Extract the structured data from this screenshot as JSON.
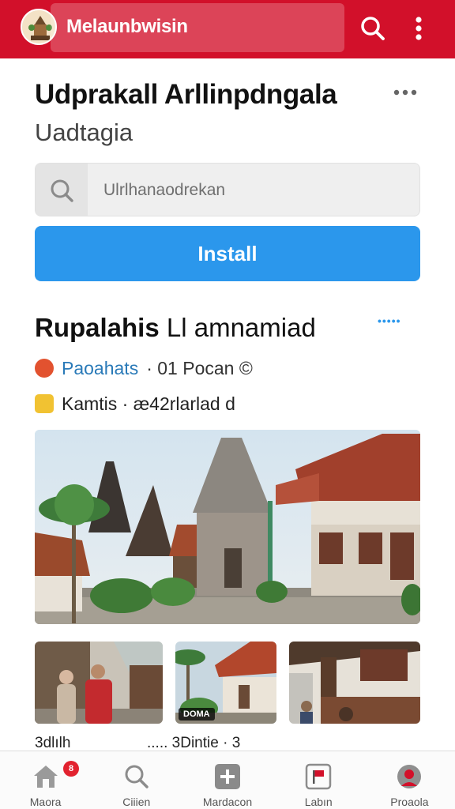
{
  "app_bar": {
    "title": "Melaunbwisin",
    "logo_icon": "temple-avatar-icon",
    "search_icon": "search-icon",
    "more_icon": "more-vertical-icon",
    "color": "#d2102a"
  },
  "header": {
    "title": "Udprakall Arllinpdngala",
    "subtitle": "Uadtagia",
    "more_icon": "more-horizontal-icon"
  },
  "search": {
    "placeholder": "Ulrlhanaodrekan",
    "icon": "search-icon"
  },
  "install_button": {
    "label": "Install",
    "color": "#2b97ec"
  },
  "section": {
    "title_bold": "Rupalahis",
    "title_light": "Ll amnamiad",
    "more_label": "•••••",
    "meta_1": {
      "icon": "location-badge-icon",
      "link": "Paoahats",
      "rest": "· 01 Pocan ©"
    },
    "meta_2": {
      "icon": "tag-icon",
      "rest": "Kamtis · æ42rlarlad d"
    }
  },
  "gallery": {
    "hero_alt": "temple-complex-photo",
    "thumbs": [
      {
        "name": "people-photo"
      },
      {
        "name": "village-photo",
        "label": "DOMA"
      },
      {
        "name": "house-photo"
      }
    ],
    "caption_1": "3dlılh",
    "caption_2": "..... 3Dintie · 3"
  },
  "bottom_nav": [
    {
      "label": "Maora",
      "icon": "home-icon",
      "badge": "8"
    },
    {
      "label": "Ciiien",
      "icon": "search-icon"
    },
    {
      "label": "Mardacon",
      "icon": "add-icon"
    },
    {
      "label": "Labın",
      "icon": "flag-icon"
    },
    {
      "label": "Proaola",
      "icon": "profile-icon"
    }
  ]
}
